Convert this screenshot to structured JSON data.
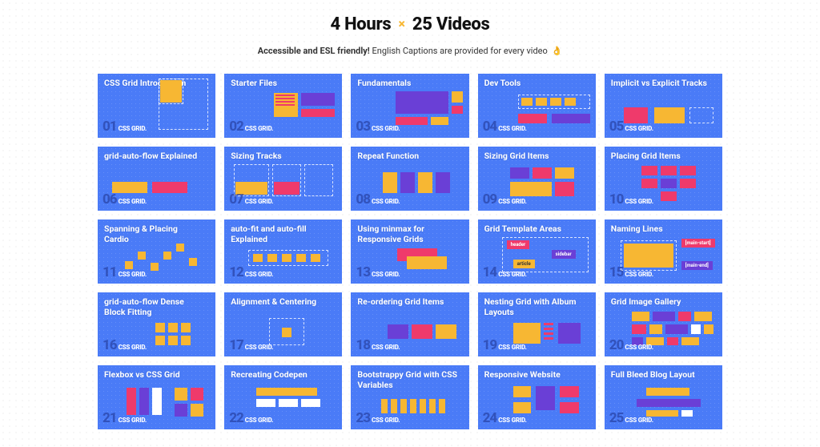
{
  "heading": {
    "hours": "4 Hours",
    "x": "×",
    "videos": "25 Videos"
  },
  "subtitle": {
    "bold": "Accessible and ESL friendly!",
    "rest": "English Captions are provided for every video",
    "emoji": "👌"
  },
  "brand": "CSS GRID.",
  "cards": [
    {
      "num": "01",
      "title": "CSS Grid Introduction"
    },
    {
      "num": "02",
      "title": "Starter Files"
    },
    {
      "num": "03",
      "title": "Fundamentals"
    },
    {
      "num": "04",
      "title": "Dev Tools"
    },
    {
      "num": "05",
      "title": "Implicit vs Explicit Tracks"
    },
    {
      "num": "06",
      "title": "grid-auto-flow Explained"
    },
    {
      "num": "07",
      "title": "Sizing Tracks"
    },
    {
      "num": "08",
      "title": "Repeat Function"
    },
    {
      "num": "09",
      "title": "Sizing Grid Items"
    },
    {
      "num": "10",
      "title": "Placing Grid Items"
    },
    {
      "num": "11",
      "title": "Spanning & Placing Cardio"
    },
    {
      "num": "12",
      "title": "auto-fit and auto-fill Explained"
    },
    {
      "num": "13",
      "title": "Using minmax for Responsive Grids"
    },
    {
      "num": "14",
      "title": "Grid Template Areas"
    },
    {
      "num": "15",
      "title": "Naming Lines"
    },
    {
      "num": "16",
      "title": "grid-auto-flow Dense Block Fitting"
    },
    {
      "num": "17",
      "title": "Alignment & Centering"
    },
    {
      "num": "18",
      "title": "Re-ordering Grid Items"
    },
    {
      "num": "19",
      "title": "Nesting Grid with Album Layouts"
    },
    {
      "num": "20",
      "title": "Grid Image Gallery"
    },
    {
      "num": "21",
      "title": "Flexbox vs CSS Grid"
    },
    {
      "num": "22",
      "title": "Recreating Codepen"
    },
    {
      "num": "23",
      "title": "Bootstrappy Grid with CSS Variables"
    },
    {
      "num": "24",
      "title": "Responsive Website"
    },
    {
      "num": "25",
      "title": "Full Bleed Blog Layout"
    }
  ],
  "area_tags": {
    "header": "header",
    "sidebar": "sidebar",
    "article": "article"
  },
  "line_tags": {
    "start": "[main-start]",
    "end": "[main-end]"
  }
}
